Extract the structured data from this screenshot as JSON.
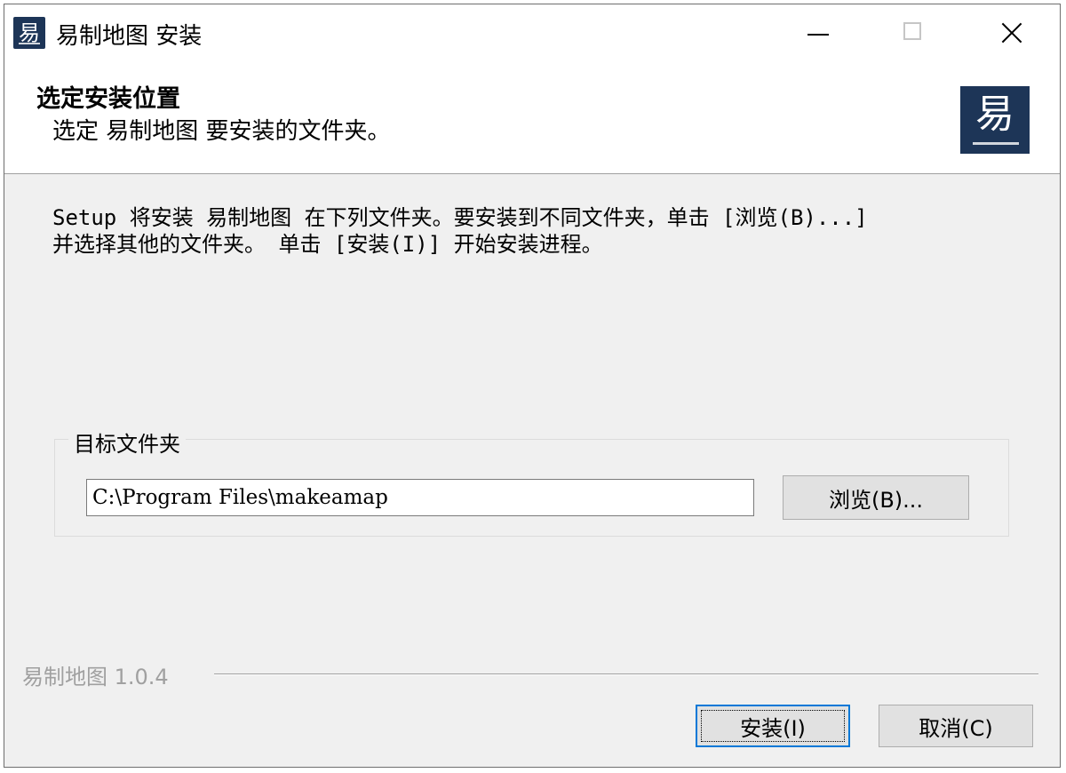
{
  "window": {
    "title": "易制地图 安装",
    "icon_glyph": "易"
  },
  "header": {
    "title": "选定安装位置",
    "subtitle": "选定 易制地图 要安装的文件夹。",
    "logo_glyph": "易"
  },
  "body": {
    "description": "Setup 将安装 易制地图 在下列文件夹。要安装到不同文件夹，单击 [浏览(B)...]\n并选择其他的文件夹。 单击 [安装(I)] 开始安装进程。",
    "group_label": "目标文件夹",
    "path_value": "C:\\Program Files\\makeamap",
    "browse_label": "浏览(B)..."
  },
  "footer": {
    "version": "易制地图 1.0.4",
    "install_label": "安装(I)",
    "cancel_label": "取消(C)"
  },
  "colors": {
    "accent": "#0078d7",
    "logo_bg": "#1d3557",
    "panel_bg": "#f0f0f0"
  }
}
